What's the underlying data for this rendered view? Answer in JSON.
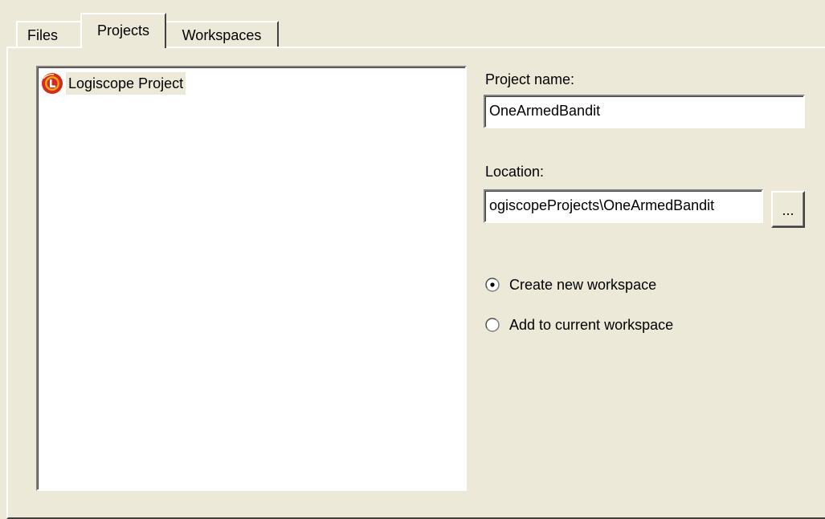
{
  "tabs": {
    "files": "Files",
    "projects": "Projects",
    "workspaces": "Workspaces"
  },
  "project_types": [
    {
      "label": "Logiscope Project",
      "icon": "logiscope-logo-icon",
      "selected": true
    }
  ],
  "project_name": {
    "label": "Project name:",
    "value": "OneArmedBandit"
  },
  "location": {
    "label": "Location:",
    "value": "ogiscopeProjects\\OneArmedBandit",
    "browse_label": "..."
  },
  "workspace_options": [
    {
      "label": "Create new workspace",
      "checked": true
    },
    {
      "label": "Add to current workspace",
      "checked": false
    }
  ],
  "colors": {
    "dialog_bg": "#ece9d8",
    "logo_red": "#d52b1e",
    "logo_orange": "#f7a21b"
  }
}
